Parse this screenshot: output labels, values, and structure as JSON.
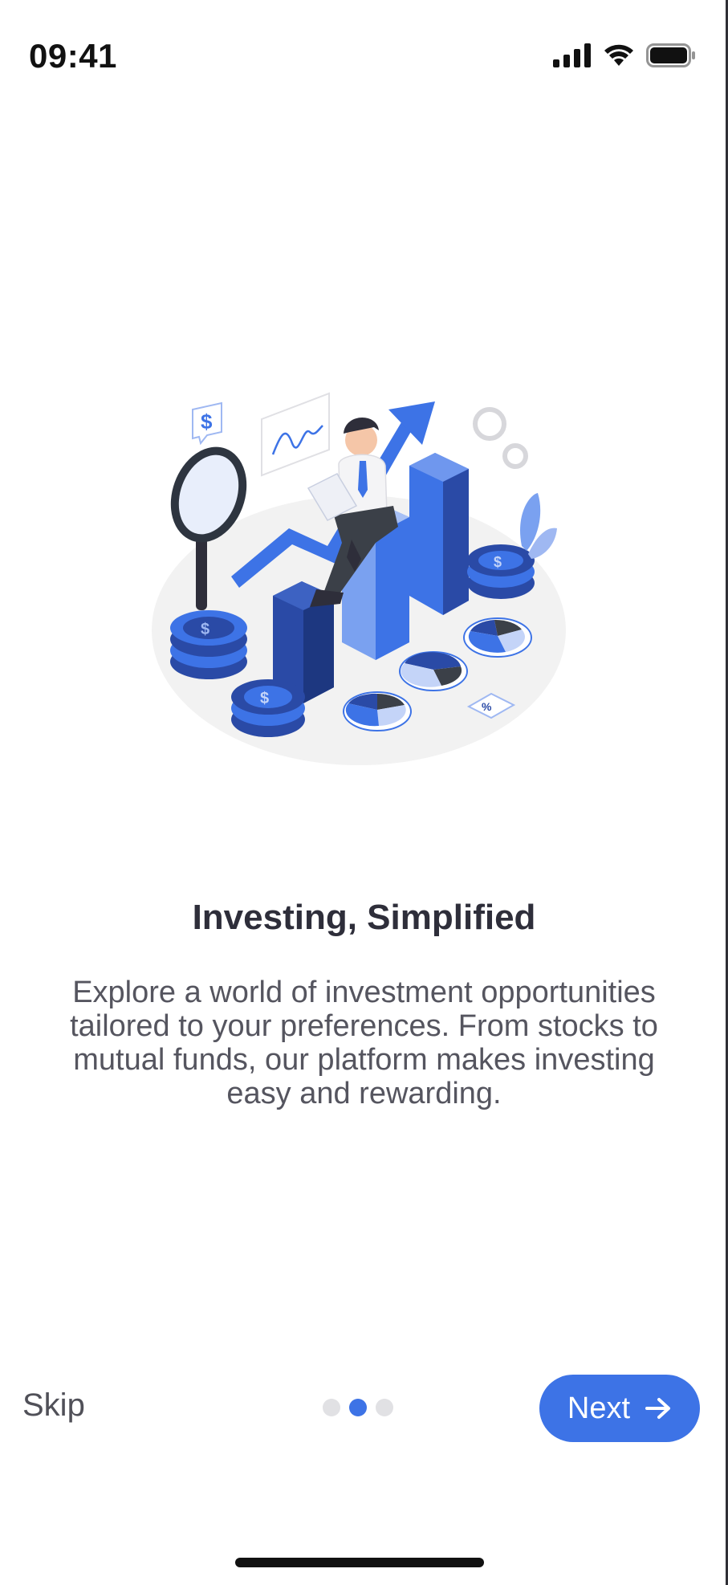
{
  "status_bar": {
    "time": "09:41",
    "icons": [
      "signal-icon",
      "wifi-icon",
      "battery-icon"
    ]
  },
  "illustration": {
    "name": "investing-illustration",
    "colors": {
      "primary": "#3d73e6",
      "dark": "#2a4aa6",
      "light": "#9fb8f2",
      "base": "#f2f2f2"
    }
  },
  "onboarding": {
    "title": "Investing, Simplified",
    "description": "Explore a world of investment opportunities tailored to your preferences. From stocks to mutual funds, our platform makes investing easy and rewarding."
  },
  "controls": {
    "skip_label": "Skip",
    "next_label": "Next",
    "next_icon": "arrow-right-icon",
    "pager": {
      "total": 3,
      "current": 2
    }
  },
  "theme": {
    "accent": "#3d73e6",
    "inactive_dot": "#e1e1e4"
  }
}
